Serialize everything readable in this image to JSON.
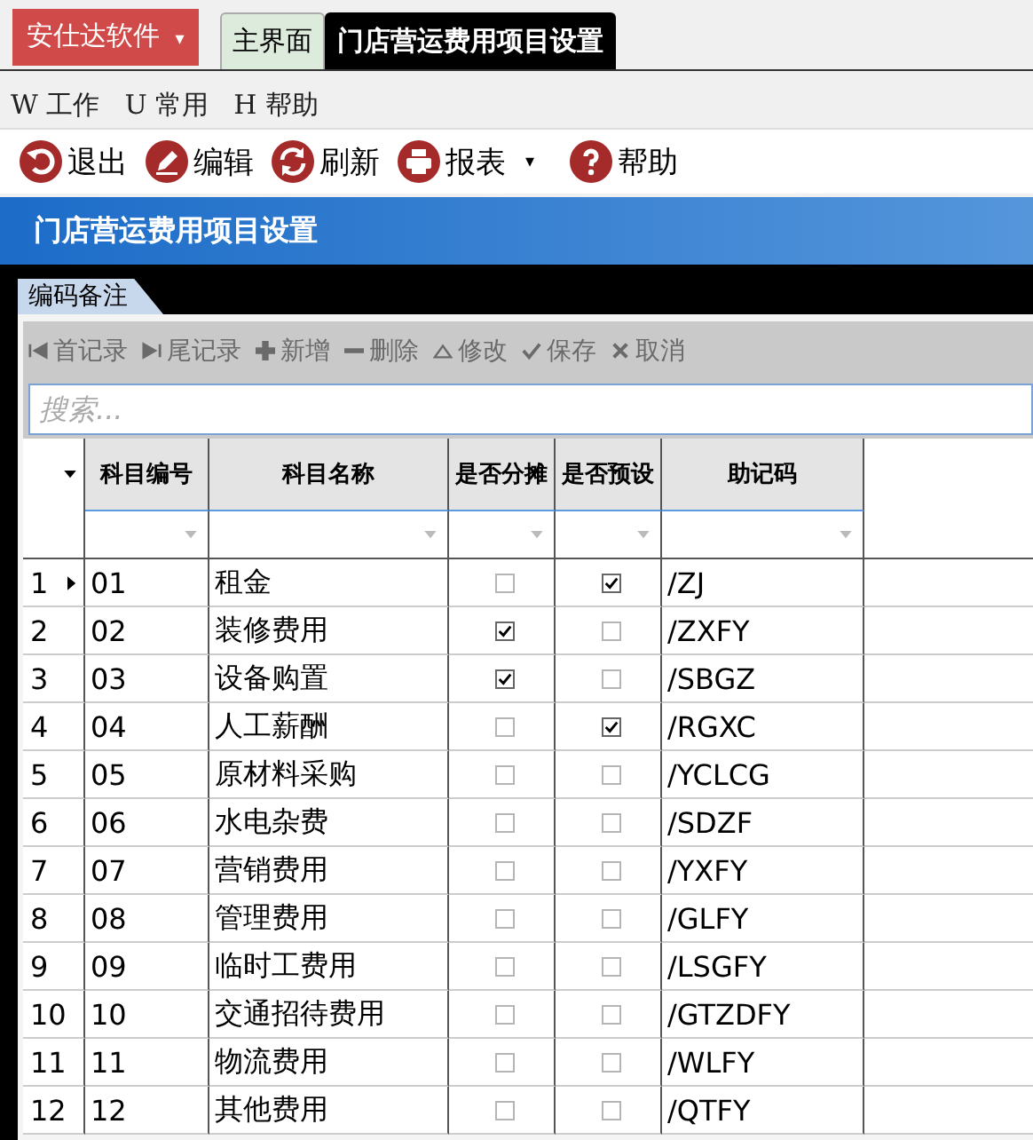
{
  "app_menu": {
    "label": "安仕达软件",
    "caret": "▾"
  },
  "window_tabs": [
    {
      "label": "主界面",
      "selected": false
    },
    {
      "label": "门店营运费用项目设置",
      "selected": true
    }
  ],
  "menu": [
    "W 工作",
    "U 常用",
    "H 帮助"
  ],
  "toolbar": [
    {
      "kind": "exit",
      "label": "退出"
    },
    {
      "kind": "edit",
      "label": "编辑"
    },
    {
      "kind": "refresh",
      "label": "刷新"
    },
    {
      "kind": "print",
      "label": "报表",
      "caret": "▾"
    },
    {
      "kind": "help",
      "label": "帮助"
    }
  ],
  "title": "门店营运费用项目设置",
  "sub_tabs": [
    "编码备注"
  ],
  "nav": [
    {
      "kind": "first",
      "label": "首记录",
      "disabled": true
    },
    {
      "kind": "last",
      "label": "尾记录",
      "disabled": true
    },
    {
      "kind": "add",
      "label": "新增",
      "disabled": true
    },
    {
      "kind": "delete",
      "label": "删除",
      "disabled": true
    },
    {
      "kind": "modify",
      "label": "修改",
      "disabled": true
    },
    {
      "kind": "save",
      "label": "保存",
      "disabled": true
    },
    {
      "kind": "cancel",
      "label": "取消",
      "disabled": true
    }
  ],
  "search": {
    "placeholder": "搜索..."
  },
  "table": {
    "columns": [
      "科目编号",
      "科目名称",
      "是否分摊",
      "是否预设",
      "助记码"
    ],
    "rows": [
      {
        "n": "1",
        "code": "01",
        "name": "租金",
        "split": false,
        "preset": true,
        "mnemonic": "/ZJ",
        "selected": true
      },
      {
        "n": "2",
        "code": "02",
        "name": "装修费用",
        "split": true,
        "preset": false,
        "mnemonic": "/ZXFY",
        "selected": false
      },
      {
        "n": "3",
        "code": "03",
        "name": "设备购置",
        "split": true,
        "preset": false,
        "mnemonic": "/SBGZ",
        "selected": false
      },
      {
        "n": "4",
        "code": "04",
        "name": "人工薪酬",
        "split": false,
        "preset": true,
        "mnemonic": "/RGXC",
        "selected": false
      },
      {
        "n": "5",
        "code": "05",
        "name": "原材料采购",
        "split": false,
        "preset": false,
        "mnemonic": "/YCLCG",
        "selected": false
      },
      {
        "n": "6",
        "code": "06",
        "name": "水电杂费",
        "split": false,
        "preset": false,
        "mnemonic": "/SDZF",
        "selected": false
      },
      {
        "n": "7",
        "code": "07",
        "name": "营销费用",
        "split": false,
        "preset": false,
        "mnemonic": "/YXFY",
        "selected": false
      },
      {
        "n": "8",
        "code": "08",
        "name": "管理费用",
        "split": false,
        "preset": false,
        "mnemonic": "/GLFY",
        "selected": false
      },
      {
        "n": "9",
        "code": "09",
        "name": "临时工费用",
        "split": false,
        "preset": false,
        "mnemonic": "/LSGFY",
        "selected": false
      },
      {
        "n": "10",
        "code": "10",
        "name": "交通招待费用",
        "split": false,
        "preset": false,
        "mnemonic": "/GTZDFY",
        "selected": false
      },
      {
        "n": "11",
        "code": "11",
        "name": "物流费用",
        "split": false,
        "preset": false,
        "mnemonic": "/WLFY",
        "selected": false
      },
      {
        "n": "12",
        "code": "12",
        "name": "其他费用",
        "split": false,
        "preset": false,
        "mnemonic": "/QTFY",
        "selected": false
      }
    ]
  }
}
